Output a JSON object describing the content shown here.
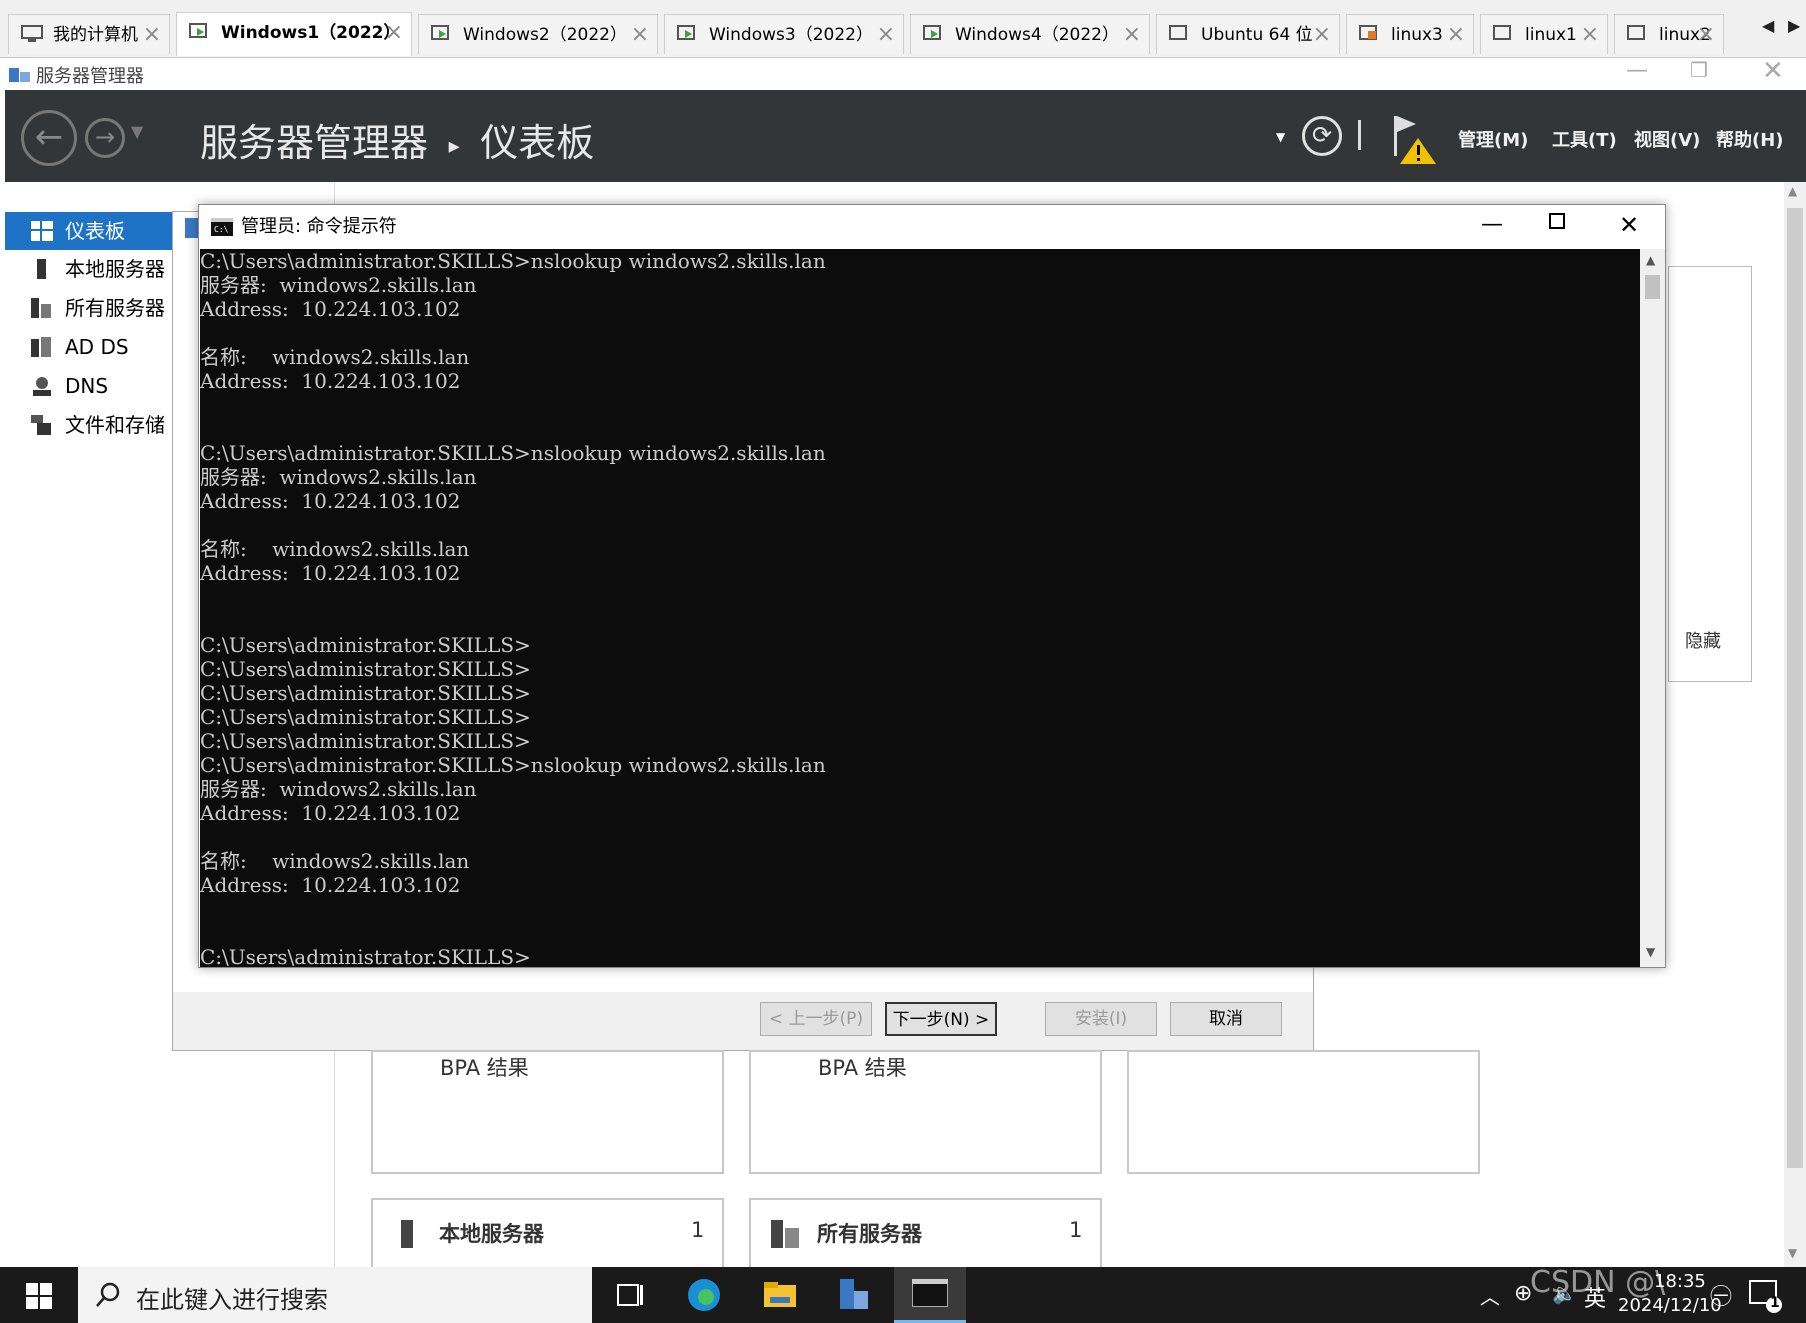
{
  "vm_tabs": [
    {
      "label": "我的计算机",
      "active": false
    },
    {
      "label": "Windows1（2022）",
      "active": true
    },
    {
      "label": "Windows2（2022）",
      "active": false
    },
    {
      "label": "Windows3（2022）",
      "active": false
    },
    {
      "label": "Windows4（2022）",
      "active": false
    },
    {
      "label": "Ubuntu 64 位",
      "active": false
    },
    {
      "label": "linux3",
      "active": false
    },
    {
      "label": "linux1",
      "active": false
    },
    {
      "label": "linux2",
      "active": false
    }
  ],
  "window": {
    "title": "服务器管理器"
  },
  "header": {
    "app": "服务器管理器",
    "separator": "▸",
    "page": "仪表板",
    "menus": [
      "管理(M)",
      "工具(T)",
      "视图(V)",
      "帮助(H)"
    ]
  },
  "sidebar": {
    "items": [
      {
        "label": "仪表板",
        "active": true
      },
      {
        "label": "本地服务器",
        "active": false
      },
      {
        "label": "所有服务器",
        "active": false
      },
      {
        "label": "AD DS",
        "active": false
      },
      {
        "label": "DNS",
        "active": false
      },
      {
        "label": "文件和存储",
        "active": false
      }
    ]
  },
  "wizard": {
    "buttons": {
      "prev": "< 上一步(P)",
      "next": "下一步(N) >",
      "install": "安装(I)",
      "cancel": "取消"
    }
  },
  "tiles": {
    "bpa1": "BPA 结果",
    "bpa2": "BPA 结果",
    "local_server": "本地服务器",
    "local_server_count": "1",
    "all_servers": "所有服务器",
    "all_servers_count": "1"
  },
  "right_panel": {
    "hide_label": "隐藏"
  },
  "cmd": {
    "title": "管理员: 命令提示符",
    "lines": [
      "C:\\Users\\administrator.SKILLS>nslookup windows2.skills.lan",
      "服务器:  windows2.skills.lan",
      "Address:  10.224.103.102",
      "",
      "名称:    windows2.skills.lan",
      "Address:  10.224.103.102",
      "",
      "",
      "C:\\Users\\administrator.SKILLS>nslookup windows2.skills.lan",
      "服务器:  windows2.skills.lan",
      "Address:  10.224.103.102",
      "",
      "名称:    windows2.skills.lan",
      "Address:  10.224.103.102",
      "",
      "",
      "C:\\Users\\administrator.SKILLS>",
      "C:\\Users\\administrator.SKILLS>",
      "C:\\Users\\administrator.SKILLS>",
      "C:\\Users\\administrator.SKILLS>",
      "C:\\Users\\administrator.SKILLS>",
      "C:\\Users\\administrator.SKILLS>nslookup windows2.skills.lan",
      "服务器:  windows2.skills.lan",
      "Address:  10.224.103.102",
      "",
      "名称:    windows2.skills.lan",
      "Address:  10.224.103.102",
      "",
      "",
      "C:\\Users\\administrator.SKILLS>"
    ]
  },
  "taskbar": {
    "search_placeholder": "在此键入进行搜索",
    "time": "18:35",
    "date": "2024/12/10",
    "ime": "英",
    "notification_count": "1",
    "watermark": "CSDN @\\"
  },
  "colors": {
    "accent": "#1f73c7",
    "header_bg": "#333638",
    "console_bg": "#0c0c0c",
    "console_fg": "#cccccc"
  }
}
